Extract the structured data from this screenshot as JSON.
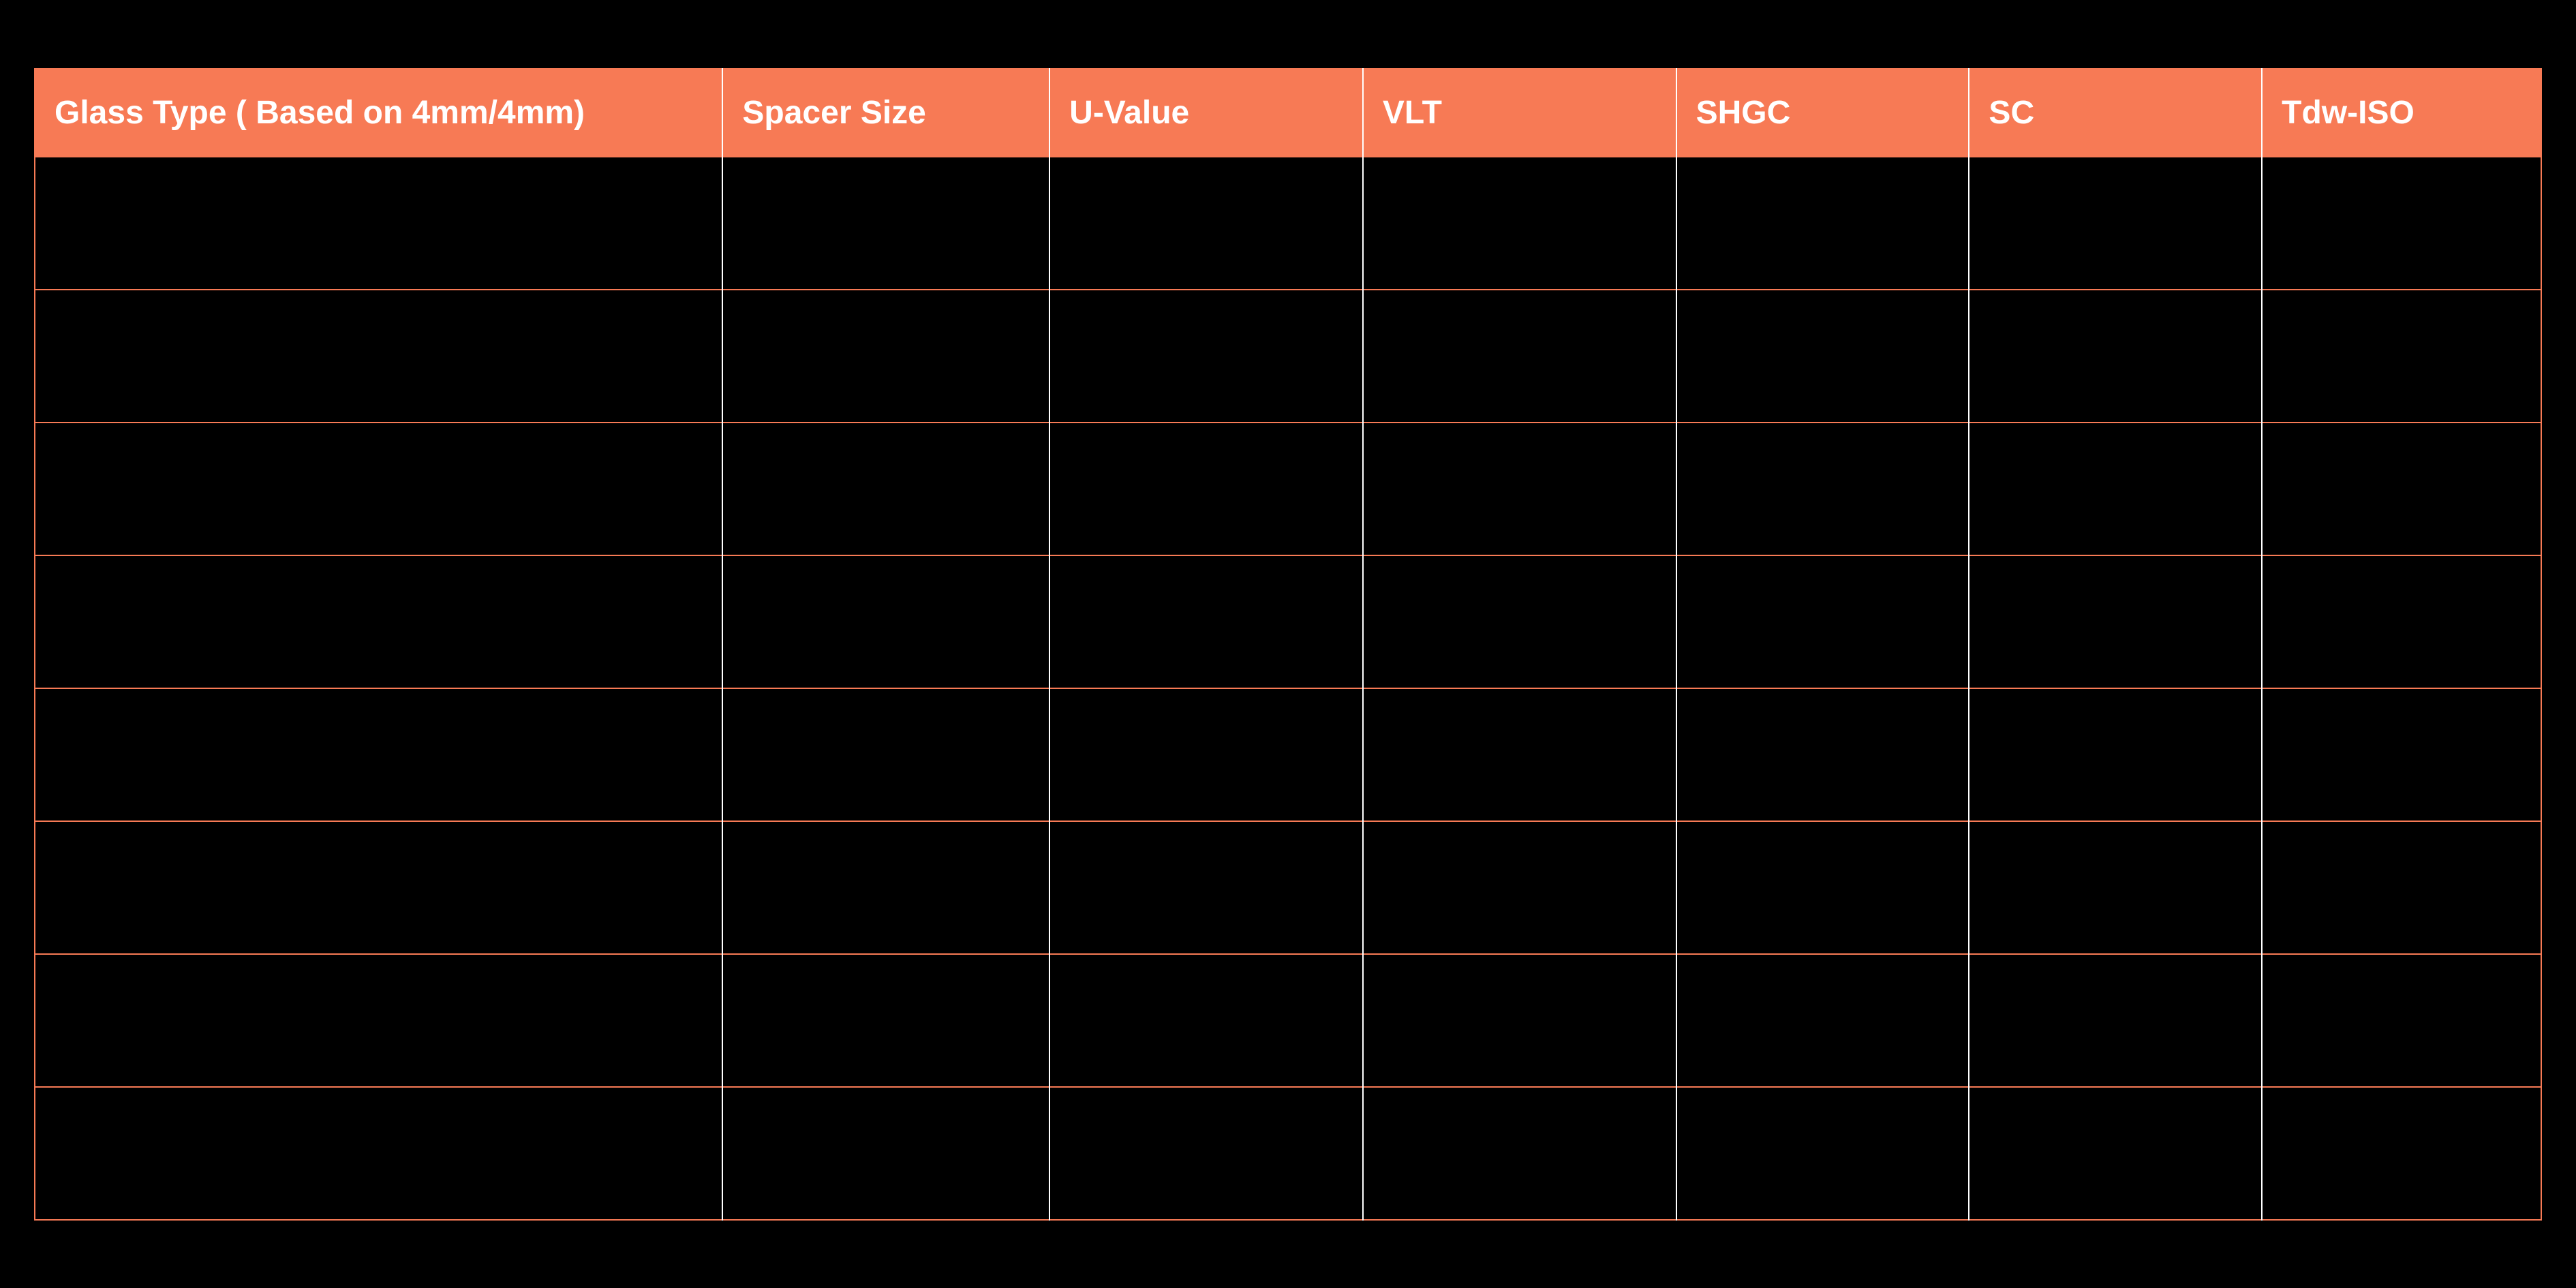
{
  "table": {
    "headers": [
      "Glass Type ( Based on 4mm/4mm)",
      "Spacer Size",
      "U-Value",
      "VLT",
      "SHGC",
      "SC",
      "Tdw-ISO"
    ],
    "rows": [
      [
        "",
        "",
        "",
        "",
        "",
        "",
        ""
      ],
      [
        "",
        "",
        "",
        "",
        "",
        "",
        ""
      ],
      [
        "",
        "",
        "",
        "",
        "",
        "",
        ""
      ],
      [
        "",
        "",
        "",
        "",
        "",
        "",
        ""
      ],
      [
        "",
        "",
        "",
        "",
        "",
        "",
        ""
      ],
      [
        "",
        "",
        "",
        "",
        "",
        "",
        ""
      ],
      [
        "",
        "",
        "",
        "",
        "",
        "",
        ""
      ],
      [
        "",
        "",
        "",
        "",
        "",
        "",
        ""
      ]
    ]
  },
  "chart_data": {
    "type": "table",
    "title": "",
    "headers": [
      "Glass Type ( Based on 4mm/4mm)",
      "Spacer Size",
      "U-Value",
      "VLT",
      "SHGC",
      "SC",
      "Tdw-ISO"
    ],
    "rows": [
      [
        "",
        "",
        "",
        "",
        "",
        "",
        ""
      ],
      [
        "",
        "",
        "",
        "",
        "",
        "",
        ""
      ],
      [
        "",
        "",
        "",
        "",
        "",
        "",
        ""
      ],
      [
        "",
        "",
        "",
        "",
        "",
        "",
        ""
      ],
      [
        "",
        "",
        "",
        "",
        "",
        "",
        ""
      ],
      [
        "",
        "",
        "",
        "",
        "",
        "",
        ""
      ],
      [
        "",
        "",
        "",
        "",
        "",
        "",
        ""
      ],
      [
        "",
        "",
        "",
        "",
        "",
        "",
        ""
      ]
    ]
  }
}
